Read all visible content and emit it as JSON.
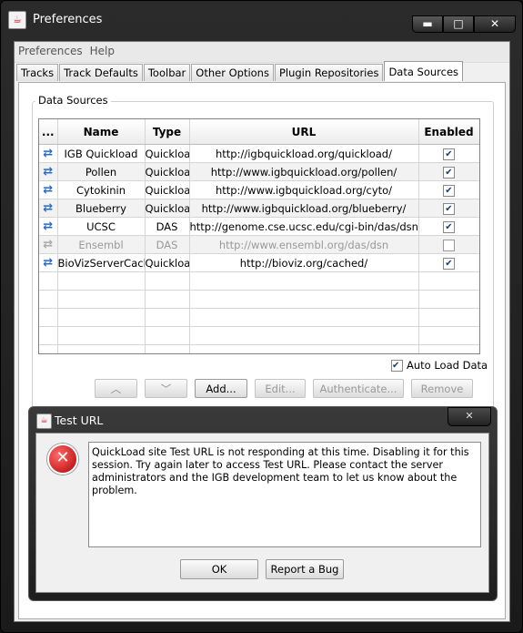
{
  "window": {
    "title": "Preferences"
  },
  "menubar": {
    "items": [
      "Preferences",
      "Help"
    ]
  },
  "tabs": [
    {
      "label": "Tracks"
    },
    {
      "label": "Track Defaults"
    },
    {
      "label": "Toolbar"
    },
    {
      "label": "Other Options"
    },
    {
      "label": "Plugin Repositories"
    },
    {
      "label": "Data Sources",
      "active": true
    }
  ],
  "data_sources": {
    "legend": "Data Sources",
    "columns": [
      "...",
      "Name",
      "Type",
      "URL",
      "Enabled"
    ],
    "rows": [
      {
        "name": "IGB Quickload",
        "type": "Quickload",
        "url": "http://igbquickload.org/quickload/",
        "enabled": true
      },
      {
        "name": "Pollen",
        "type": "Quickload",
        "url": "http://www.igbquickload.org/pollen/",
        "enabled": true
      },
      {
        "name": "Cytokinin",
        "type": "Quickload",
        "url": "http://www.igbquickload.org/cyto/",
        "enabled": true
      },
      {
        "name": "Blueberry",
        "type": "Quickload",
        "url": "http://www.igbquickload.org/blueberry/",
        "enabled": true
      },
      {
        "name": "UCSC",
        "type": "DAS",
        "url": "http://genome.cse.ucsc.edu/cgi-bin/das/dsn",
        "enabled": true
      },
      {
        "name": "Ensembl",
        "type": "DAS",
        "url": "http://www.ensembl.org/das/dsn",
        "enabled": false
      },
      {
        "name": "BioVizServerCache",
        "type": "Quickload",
        "url": "http://bioviz.org/cached/",
        "enabled": true
      }
    ],
    "auto_load_label": "Auto Load Data",
    "auto_load_checked": true,
    "buttons": {
      "up": "︿",
      "down": "﹀",
      "add": "Add...",
      "edit": "Edit...",
      "authenticate": "Authenticate...",
      "remove": "Remove"
    }
  },
  "dialog": {
    "title": "Test URL",
    "icon": "error-icon",
    "message": "QuickLoad site Test URL is not responding at this time. Disabling it for this session. Try again later to access Test URL. Please contact the server administrators and the IGB development team to let us know about the problem.",
    "ok_label": "OK",
    "report_label": "Report a Bug",
    "close_label": "✕"
  },
  "colors": {
    "refresh_icon": "#2b6cc9",
    "error_red": "#c00000"
  }
}
